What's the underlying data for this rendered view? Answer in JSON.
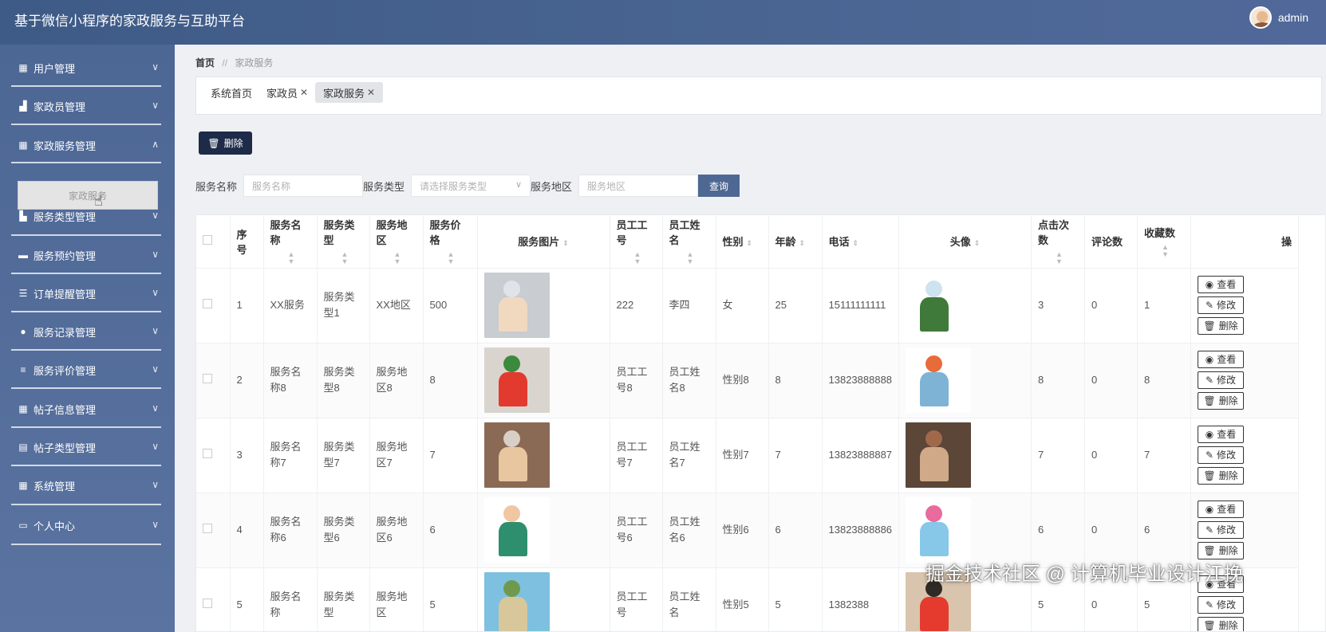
{
  "header": {
    "title": "基于微信小程序的家政服务与互助平台",
    "username": "admin"
  },
  "sidebar": {
    "items": [
      {
        "label": "用户管理",
        "icon": "grid-icon"
      },
      {
        "label": "家政员管理",
        "icon": "chart-icon"
      },
      {
        "label": "家政服务管理",
        "icon": "grid-icon"
      },
      {
        "label": "服务类型管理",
        "icon": "bar-chart-icon"
      },
      {
        "label": "服务预约管理",
        "icon": "briefcase-icon"
      },
      {
        "label": "订单提醒管理",
        "icon": "sliders-icon"
      },
      {
        "label": "服务记录管理",
        "icon": "bulb-icon"
      },
      {
        "label": "服务评价管理",
        "icon": "list-icon"
      },
      {
        "label": "帖子信息管理",
        "icon": "grid-icon"
      },
      {
        "label": "帖子类型管理",
        "icon": "clipboard-icon"
      },
      {
        "label": "系统管理",
        "icon": "grid-icon"
      },
      {
        "label": "个人中心",
        "icon": "window-icon"
      }
    ],
    "sub_item": "家政服务"
  },
  "breadcrumb": {
    "home": "首页",
    "separator": "//",
    "current": "家政服务"
  },
  "tabs": [
    {
      "label": "系统首页"
    },
    {
      "label": "家政员"
    },
    {
      "label": "家政服务"
    }
  ],
  "toolbar": {
    "delete_label": "删除"
  },
  "search": {
    "name_label": "服务名称",
    "name_placeholder": "服务名称",
    "type_label": "服务类型",
    "type_placeholder": "请选择服务类型",
    "area_label": "服务地区",
    "area_placeholder": "服务地区",
    "query_label": "查询"
  },
  "table": {
    "columns": [
      "序号",
      "服务名称",
      "服务类型",
      "服务地区",
      "服务价格",
      "服务图片",
      "员工工号",
      "员工姓名",
      "性别",
      "年龄",
      "电话",
      "头像",
      "点击次数",
      "评论数",
      "收藏数",
      "操"
    ],
    "rows": [
      {
        "idx": "1",
        "name": "XX服务",
        "type": "服务类型1",
        "area": "XX地区",
        "price": "500",
        "emp_no": "222",
        "emp_name": "李四",
        "gender": "女",
        "age": "25",
        "phone": "15111111111",
        "clicks": "3",
        "comments": "0",
        "favs": "1"
      },
      {
        "idx": "2",
        "name": "服务名称8",
        "type": "服务类型8",
        "area": "服务地区8",
        "price": "8",
        "emp_no": "员工工号8",
        "emp_name": "员工姓名8",
        "gender": "性别8",
        "age": "8",
        "phone": "13823888888",
        "clicks": "8",
        "comments": "0",
        "favs": "8"
      },
      {
        "idx": "3",
        "name": "服务名称7",
        "type": "服务类型7",
        "area": "服务地区7",
        "price": "7",
        "emp_no": "员工工号7",
        "emp_name": "员工姓名7",
        "gender": "性别7",
        "age": "7",
        "phone": "13823888887",
        "clicks": "7",
        "comments": "0",
        "favs": "7"
      },
      {
        "idx": "4",
        "name": "服务名称6",
        "type": "服务类型6",
        "area": "服务地区6",
        "price": "6",
        "emp_no": "员工工号6",
        "emp_name": "员工姓名6",
        "gender": "性别6",
        "age": "6",
        "phone": "13823888886",
        "clicks": "6",
        "comments": "0",
        "favs": "6"
      },
      {
        "idx": "5",
        "name": "服务名称",
        "type": "服务类型",
        "area": "服务地区",
        "price": "5",
        "emp_no": "员工工号",
        "emp_name": "员工姓名",
        "gender": "性别5",
        "age": "5",
        "phone": "1382388",
        "clicks": "5",
        "comments": "0",
        "favs": "5"
      }
    ],
    "view_label": "查看",
    "edit_label": "修改",
    "delete_label": "删除"
  },
  "watermark": "掘金技术社区 @ 计算机毕业设计江挽"
}
